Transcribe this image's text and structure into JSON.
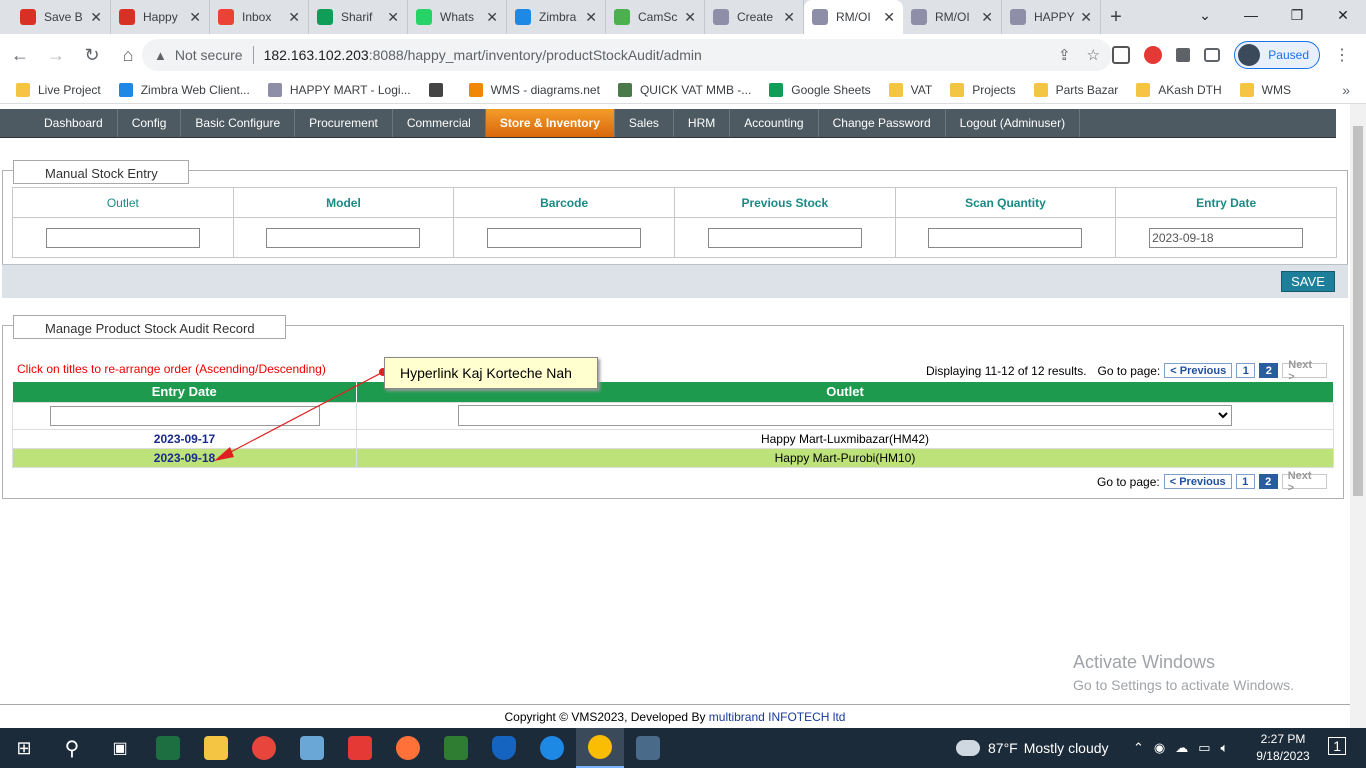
{
  "browser": {
    "tabs": [
      {
        "title": "Save B",
        "color": "#d93025"
      },
      {
        "title": "Happy",
        "color": "#d93025"
      },
      {
        "title": "Inbox",
        "color": "#ea4335"
      },
      {
        "title": "Sharif",
        "color": "#0f9d58"
      },
      {
        "title": "Whats",
        "color": "#25d366"
      },
      {
        "title": "Zimbra",
        "color": "#1e88e5"
      },
      {
        "title": "CamSc",
        "color": "#4caf50"
      },
      {
        "title": "Create",
        "color": "#8e8ea8"
      },
      {
        "title": "RM/OI",
        "color": "#8e8ea8",
        "active": true
      },
      {
        "title": "RM/OI",
        "color": "#8e8ea8"
      },
      {
        "title": "HAPPY",
        "color": "#8e8ea8"
      }
    ],
    "not_secure": "Not secure",
    "url_host": "182.163.102.203",
    "url_rest": ":8088/happy_mart/inventory/productStockAudit/admin",
    "paused_label": "Paused",
    "bookmarks": [
      {
        "label": "Live Project",
        "color": "#f4c542"
      },
      {
        "label": "Zimbra Web Client...",
        "color": "#1e88e5"
      },
      {
        "label": "HAPPY MART - Logi...",
        "color": "#8e8ea8"
      },
      {
        "label": "",
        "color": "#444"
      },
      {
        "label": "WMS - diagrams.net",
        "color": "#f08705"
      },
      {
        "label": "QUICK VAT MMB -...",
        "color": "#4a7a4a"
      },
      {
        "label": "Google Sheets",
        "color": "#0f9d58"
      },
      {
        "label": "VAT",
        "color": "#f4c542"
      },
      {
        "label": "Projects",
        "color": "#f4c542"
      },
      {
        "label": "Parts Bazar",
        "color": "#f4c542"
      },
      {
        "label": "AKash DTH",
        "color": "#f4c542"
      },
      {
        "label": "WMS",
        "color": "#f4c542"
      }
    ]
  },
  "menu": [
    {
      "label": "Dashboard"
    },
    {
      "label": "Config"
    },
    {
      "label": "Basic Configure"
    },
    {
      "label": "Procurement"
    },
    {
      "label": "Commercial"
    },
    {
      "label": "Store & Inventory",
      "active": true
    },
    {
      "label": "Sales"
    },
    {
      "label": "HRM"
    },
    {
      "label": "Accounting"
    },
    {
      "label": "Change Password"
    },
    {
      "label": "Logout (Adminuser)"
    }
  ],
  "manual_entry": {
    "legend": "Manual Stock Entry",
    "columns": [
      "Outlet",
      "Model",
      "Barcode",
      "Previous Stock",
      "Scan Quantity",
      "Entry Date"
    ],
    "entry_date_value": "2023-09-18",
    "save_label": "SAVE"
  },
  "audit": {
    "legend": "Manage Product Stock Audit Record",
    "hint": "Click on titles to re-arrange order (Ascending/Descending)",
    "callout": "Hyperlink Kaj Korteche Nah",
    "summary": "Displaying 11-12 of 12 results.",
    "goto_label": "Go to page:",
    "prev_label": "< Previous",
    "next_label": "Next >",
    "pages": [
      "1",
      "2"
    ],
    "current_page": "2",
    "headers": [
      "Entry Date",
      "Outlet"
    ],
    "rows": [
      {
        "date": "2023-09-17",
        "outlet": "Happy Mart-Luxmibazar(HM42)"
      },
      {
        "date": "2023-09-18",
        "outlet": "Happy Mart-Purobi(HM10)"
      }
    ]
  },
  "watermark": {
    "line1": "Activate Windows",
    "line2": "Go to Settings to activate Windows."
  },
  "footer": {
    "text": "Copyright © VMS2023, Developed By ",
    "link": "multibrand INFOTECH ltd"
  },
  "taskbar": {
    "weather_temp": "87°F",
    "weather_text": "Mostly cloudy",
    "time": "2:27 PM",
    "date": "9/18/2023",
    "notif_count": "1"
  }
}
